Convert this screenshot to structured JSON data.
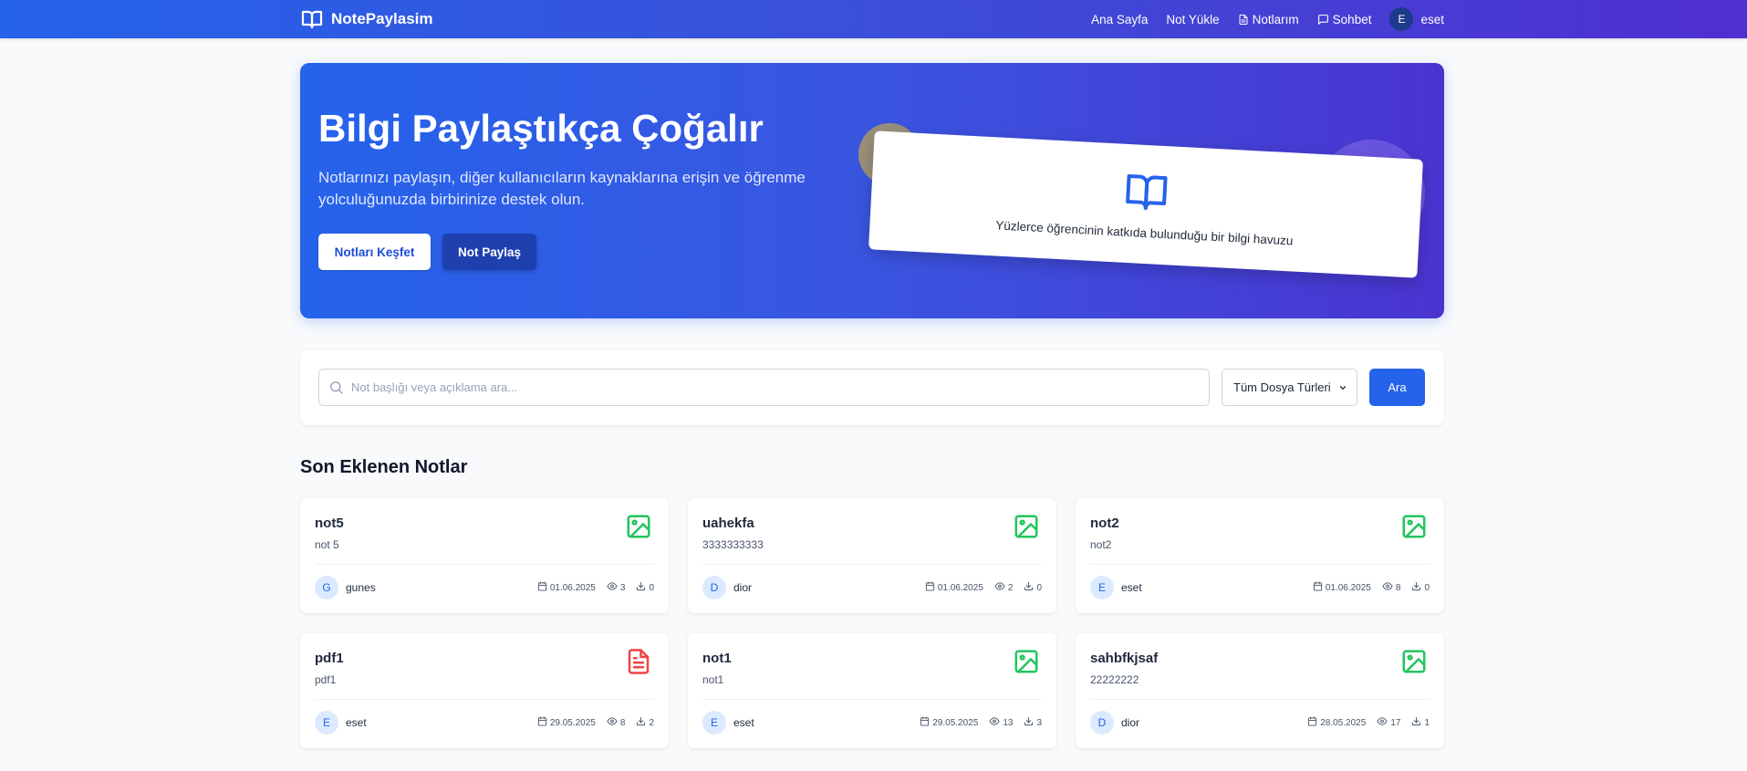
{
  "navbar": {
    "brand": "NotePaylasim",
    "links": {
      "home": "Ana Sayfa",
      "upload": "Not Yükle",
      "my_notes": "Notlarım",
      "chat": "Sohbet"
    },
    "user": {
      "initial": "E",
      "name": "eset"
    }
  },
  "hero": {
    "title": "Bilgi Paylaştıkça Çoğalır",
    "subtitle": "Notlarınızı paylaşın, diğer kullanıcıların kaynaklarına erişin ve öğrenme yolculuğunuzda birbirinize destek olun.",
    "explore_label": "Notları Keşfet",
    "share_label": "Not Paylaş",
    "card_text": "Yüzlerce öğrencinin katkıda bulunduğu bir bilgi havuzu"
  },
  "search": {
    "placeholder": "Not başlığı veya açıklama ara...",
    "type_selected": "Tüm Dosya Türleri",
    "button_label": "Ara"
  },
  "notes_section": {
    "title": "Son Eklenen Notlar",
    "notes": [
      {
        "title": "not5",
        "description": "not 5",
        "icon": "image-icon",
        "author_initial": "G",
        "author": "gunes",
        "date": "01.06.2025",
        "views": "3",
        "downloads": "0"
      },
      {
        "title": "uahekfa",
        "description": "3333333333",
        "icon": "image-icon",
        "author_initial": "D",
        "author": "dior",
        "date": "01.06.2025",
        "views": "2",
        "downloads": "0"
      },
      {
        "title": "not2",
        "description": "not2",
        "icon": "image-icon",
        "author_initial": "E",
        "author": "eset",
        "date": "01.06.2025",
        "views": "8",
        "downloads": "0"
      },
      {
        "title": "pdf1",
        "description": "pdf1",
        "icon": "pdf-icon",
        "author_initial": "E",
        "author": "eset",
        "date": "29.05.2025",
        "views": "8",
        "downloads": "2"
      },
      {
        "title": "not1",
        "description": "not1",
        "icon": "image-icon",
        "author_initial": "E",
        "author": "eset",
        "date": "29.05.2025",
        "views": "13",
        "downloads": "3"
      },
      {
        "title": "sahbfkjsaf",
        "description": "22222222",
        "icon": "image-icon",
        "author_initial": "D",
        "author": "dior",
        "date": "28.05.2025",
        "views": "17",
        "downloads": "1"
      }
    ]
  },
  "colors": {
    "primary": "#2563eb",
    "image_icon": "#22c55e",
    "pdf_icon": "#ef4444",
    "hero_end": "#4a34d0"
  }
}
